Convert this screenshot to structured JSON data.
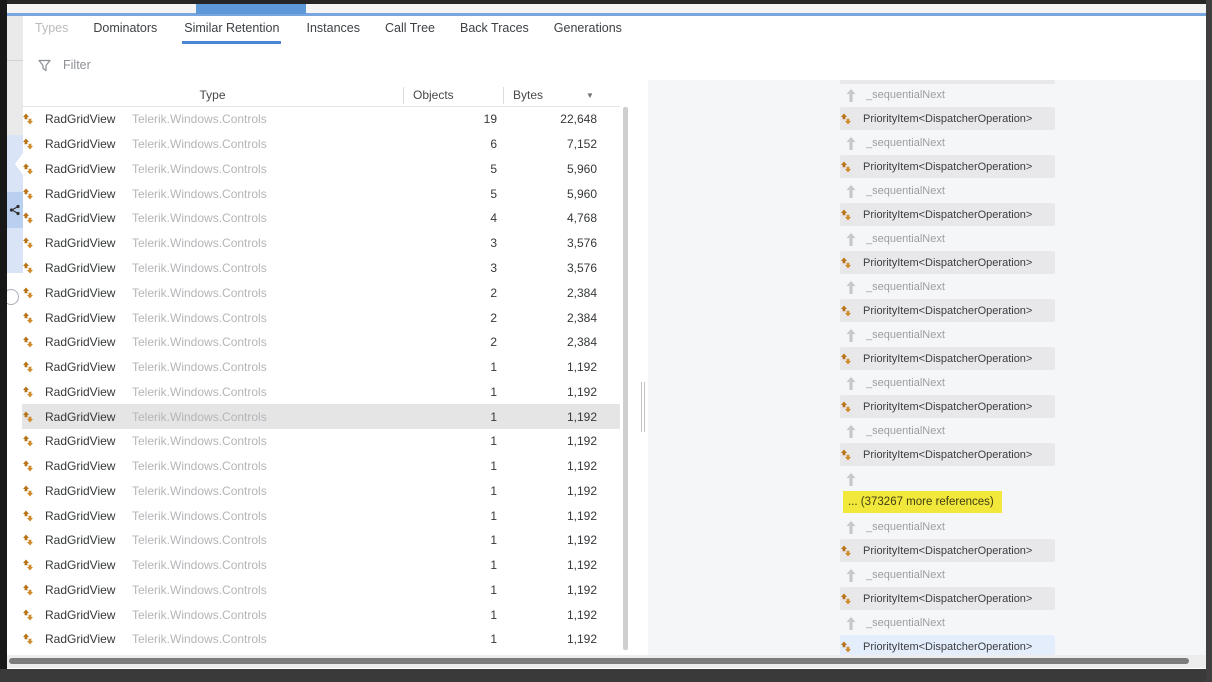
{
  "colors": {
    "accent_line": "#7aa6df",
    "segment": "#5d99d8",
    "tab_underline": "#4c85d6",
    "highlight_yellow": "#f2e73b",
    "selected_node_bg": "#e4edfb",
    "node_bg": "#e8e8ea",
    "icon_orange_dark": "#b87318",
    "icon_orange_light": "#d08c2c"
  },
  "tabs": {
    "items": [
      {
        "label": "Types",
        "state": "dimmed"
      },
      {
        "label": "Dominators",
        "state": "normal"
      },
      {
        "label": "Similar Retention",
        "state": "active"
      },
      {
        "label": "Instances",
        "state": "normal"
      },
      {
        "label": "Call Tree",
        "state": "normal"
      },
      {
        "label": "Back Traces",
        "state": "normal"
      },
      {
        "label": "Generations",
        "state": "normal"
      }
    ]
  },
  "filter": {
    "label": "Filter",
    "icon": "funnel-icon"
  },
  "table": {
    "columns": {
      "type": "Type",
      "objects": "Objects",
      "bytes": "Bytes"
    },
    "sort_icon": "▼",
    "rows": [
      {
        "type": "RadGridView",
        "namespace": "Telerik.Windows.Controls",
        "objects": "19",
        "bytes": "22,648",
        "selected": false
      },
      {
        "type": "RadGridView",
        "namespace": "Telerik.Windows.Controls",
        "objects": "6",
        "bytes": "7,152",
        "selected": false
      },
      {
        "type": "RadGridView",
        "namespace": "Telerik.Windows.Controls",
        "objects": "5",
        "bytes": "5,960",
        "selected": false
      },
      {
        "type": "RadGridView",
        "namespace": "Telerik.Windows.Controls",
        "objects": "5",
        "bytes": "5,960",
        "selected": false
      },
      {
        "type": "RadGridView",
        "namespace": "Telerik.Windows.Controls",
        "objects": "4",
        "bytes": "4,768",
        "selected": false
      },
      {
        "type": "RadGridView",
        "namespace": "Telerik.Windows.Controls",
        "objects": "3",
        "bytes": "3,576",
        "selected": false
      },
      {
        "type": "RadGridView",
        "namespace": "Telerik.Windows.Controls",
        "objects": "3",
        "bytes": "3,576",
        "selected": false
      },
      {
        "type": "RadGridView",
        "namespace": "Telerik.Windows.Controls",
        "objects": "2",
        "bytes": "2,384",
        "selected": false
      },
      {
        "type": "RadGridView",
        "namespace": "Telerik.Windows.Controls",
        "objects": "2",
        "bytes": "2,384",
        "selected": false
      },
      {
        "type": "RadGridView",
        "namespace": "Telerik.Windows.Controls",
        "objects": "2",
        "bytes": "2,384",
        "selected": false
      },
      {
        "type": "RadGridView",
        "namespace": "Telerik.Windows.Controls",
        "objects": "1",
        "bytes": "1,192",
        "selected": false
      },
      {
        "type": "RadGridView",
        "namespace": "Telerik.Windows.Controls",
        "objects": "1",
        "bytes": "1,192",
        "selected": false
      },
      {
        "type": "RadGridView",
        "namespace": "Telerik.Windows.Controls",
        "objects": "1",
        "bytes": "1,192",
        "selected": true
      },
      {
        "type": "RadGridView",
        "namespace": "Telerik.Windows.Controls",
        "objects": "1",
        "bytes": "1,192",
        "selected": false
      },
      {
        "type": "RadGridView",
        "namespace": "Telerik.Windows.Controls",
        "objects": "1",
        "bytes": "1,192",
        "selected": false
      },
      {
        "type": "RadGridView",
        "namespace": "Telerik.Windows.Controls",
        "objects": "1",
        "bytes": "1,192",
        "selected": false
      },
      {
        "type": "RadGridView",
        "namespace": "Telerik.Windows.Controls",
        "objects": "1",
        "bytes": "1,192",
        "selected": false
      },
      {
        "type": "RadGridView",
        "namespace": "Telerik.Windows.Controls",
        "objects": "1",
        "bytes": "1,192",
        "selected": false
      },
      {
        "type": "RadGridView",
        "namespace": "Telerik.Windows.Controls",
        "objects": "1",
        "bytes": "1,192",
        "selected": false
      },
      {
        "type": "RadGridView",
        "namespace": "Telerik.Windows.Controls",
        "objects": "1",
        "bytes": "1,192",
        "selected": false
      },
      {
        "type": "RadGridView",
        "namespace": "Telerik.Windows.Controls",
        "objects": "1",
        "bytes": "1,192",
        "selected": false
      },
      {
        "type": "RadGridView",
        "namespace": "Telerik.Windows.Controls",
        "objects": "1",
        "bytes": "1,192",
        "selected": false
      }
    ]
  },
  "retention_graph": {
    "items": [
      {
        "kind": "node-partial",
        "label": ""
      },
      {
        "kind": "edge",
        "label": "_sequentialNext"
      },
      {
        "kind": "node",
        "label": "PriorityItem<DispatcherOperation>",
        "selected": false
      },
      {
        "kind": "edge",
        "label": "_sequentialNext"
      },
      {
        "kind": "node",
        "label": "PriorityItem<DispatcherOperation>",
        "selected": false
      },
      {
        "kind": "edge",
        "label": "_sequentialNext"
      },
      {
        "kind": "node",
        "label": "PriorityItem<DispatcherOperation>",
        "selected": false
      },
      {
        "kind": "edge",
        "label": "_sequentialNext"
      },
      {
        "kind": "node",
        "label": "PriorityItem<DispatcherOperation>",
        "selected": false
      },
      {
        "kind": "edge",
        "label": "_sequentialNext"
      },
      {
        "kind": "node",
        "label": "PriorityItem<DispatcherOperation>",
        "selected": false
      },
      {
        "kind": "edge",
        "label": "_sequentialNext"
      },
      {
        "kind": "node",
        "label": "PriorityItem<DispatcherOperation>",
        "selected": false
      },
      {
        "kind": "edge",
        "label": "_sequentialNext"
      },
      {
        "kind": "node",
        "label": "PriorityItem<DispatcherOperation>",
        "selected": false
      },
      {
        "kind": "edge",
        "label": "_sequentialNext"
      },
      {
        "kind": "node",
        "label": "PriorityItem<DispatcherOperation>",
        "selected": false
      },
      {
        "kind": "edge",
        "label": ""
      },
      {
        "kind": "more",
        "label": "... (373267 more references)"
      },
      {
        "kind": "edge",
        "label": "_sequentialNext"
      },
      {
        "kind": "node",
        "label": "PriorityItem<DispatcherOperation>",
        "selected": false
      },
      {
        "kind": "edge",
        "label": "_sequentialNext"
      },
      {
        "kind": "node",
        "label": "PriorityItem<DispatcherOperation>",
        "selected": false
      },
      {
        "kind": "edge",
        "label": "_sequentialNext"
      },
      {
        "kind": "node",
        "label": "PriorityItem<DispatcherOperation>",
        "selected": true
      }
    ]
  }
}
